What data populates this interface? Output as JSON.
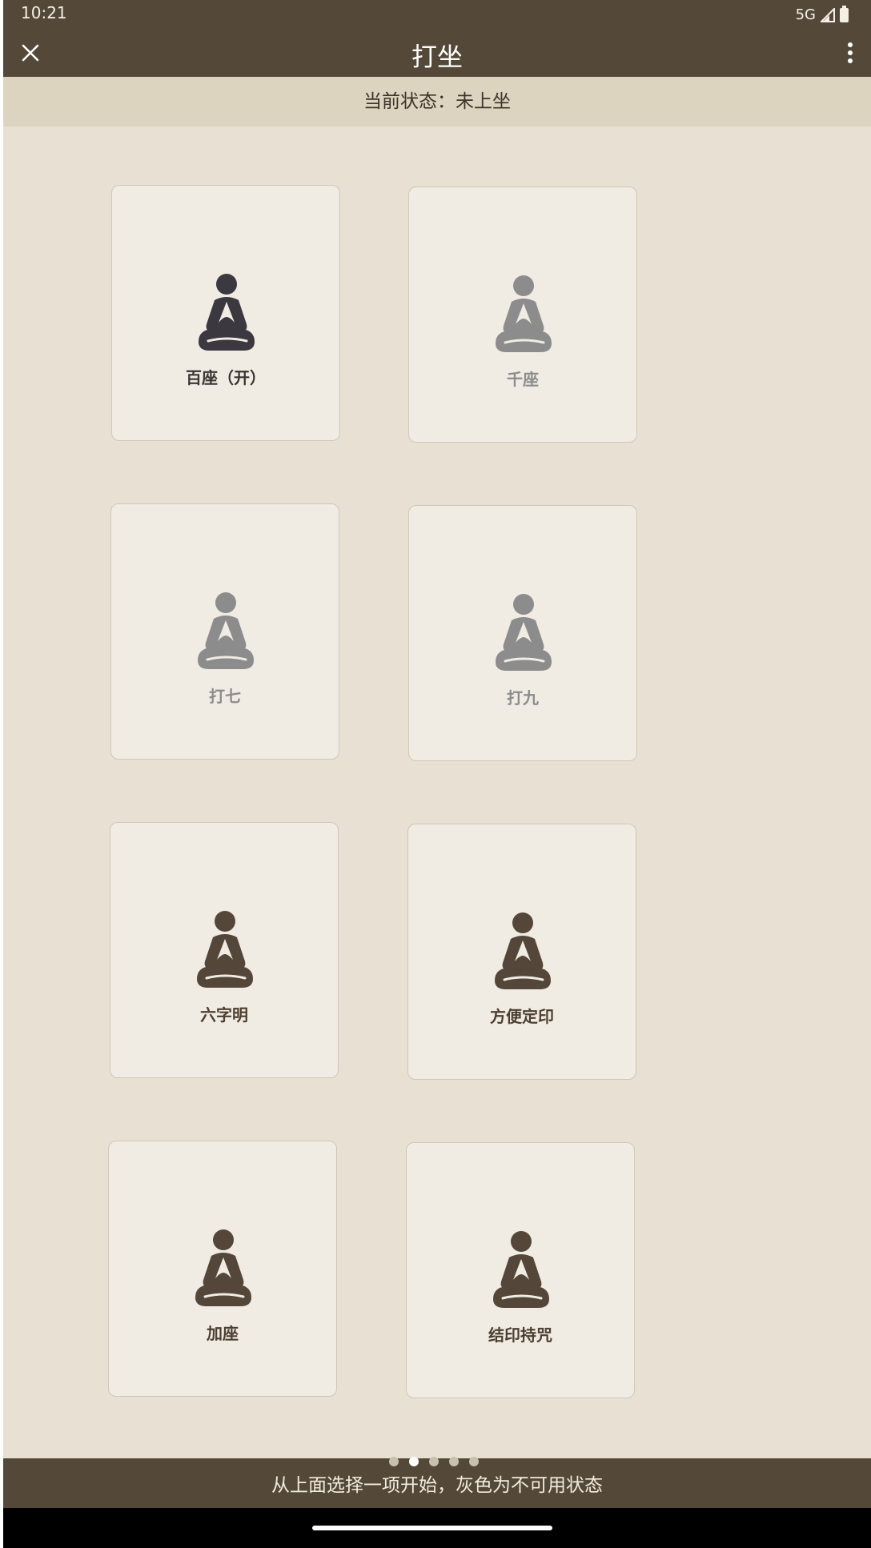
{
  "status_bar": {
    "time": "10:21",
    "network": "5G"
  },
  "toolbar": {
    "title": "打坐",
    "close_icon": "close-icon",
    "more_icon": "more-vert-icon"
  },
  "status_line": {
    "text": "当前状态：未上坐"
  },
  "colors": {
    "header": "#544838",
    "background": "#e8e1d3",
    "card": "#f0ece4",
    "figure_active": "#3c3840",
    "figure_inactive": "#8c8c8c",
    "figure_brown": "#54473a"
  },
  "options": [
    {
      "label": "百座（开）",
      "icon": "meditation-icon",
      "state": "active"
    },
    {
      "label": "千座",
      "icon": "meditation-icon",
      "state": "inactive"
    },
    {
      "label": "打七",
      "icon": "meditation-icon",
      "state": "inactive"
    },
    {
      "label": "打九",
      "icon": "meditation-icon",
      "state": "inactive"
    },
    {
      "label": "六字明",
      "icon": "meditation-icon",
      "state": "brown"
    },
    {
      "label": "方便定印",
      "icon": "meditation-icon",
      "state": "brown"
    },
    {
      "label": "加座",
      "icon": "meditation-icon",
      "state": "brown"
    },
    {
      "label": "结印持咒",
      "icon": "meditation-icon",
      "state": "brown"
    }
  ],
  "pager": {
    "count": 5,
    "active_index": 1
  },
  "footer": {
    "hint": "从上面选择一项开始，灰色为不可用状态"
  }
}
